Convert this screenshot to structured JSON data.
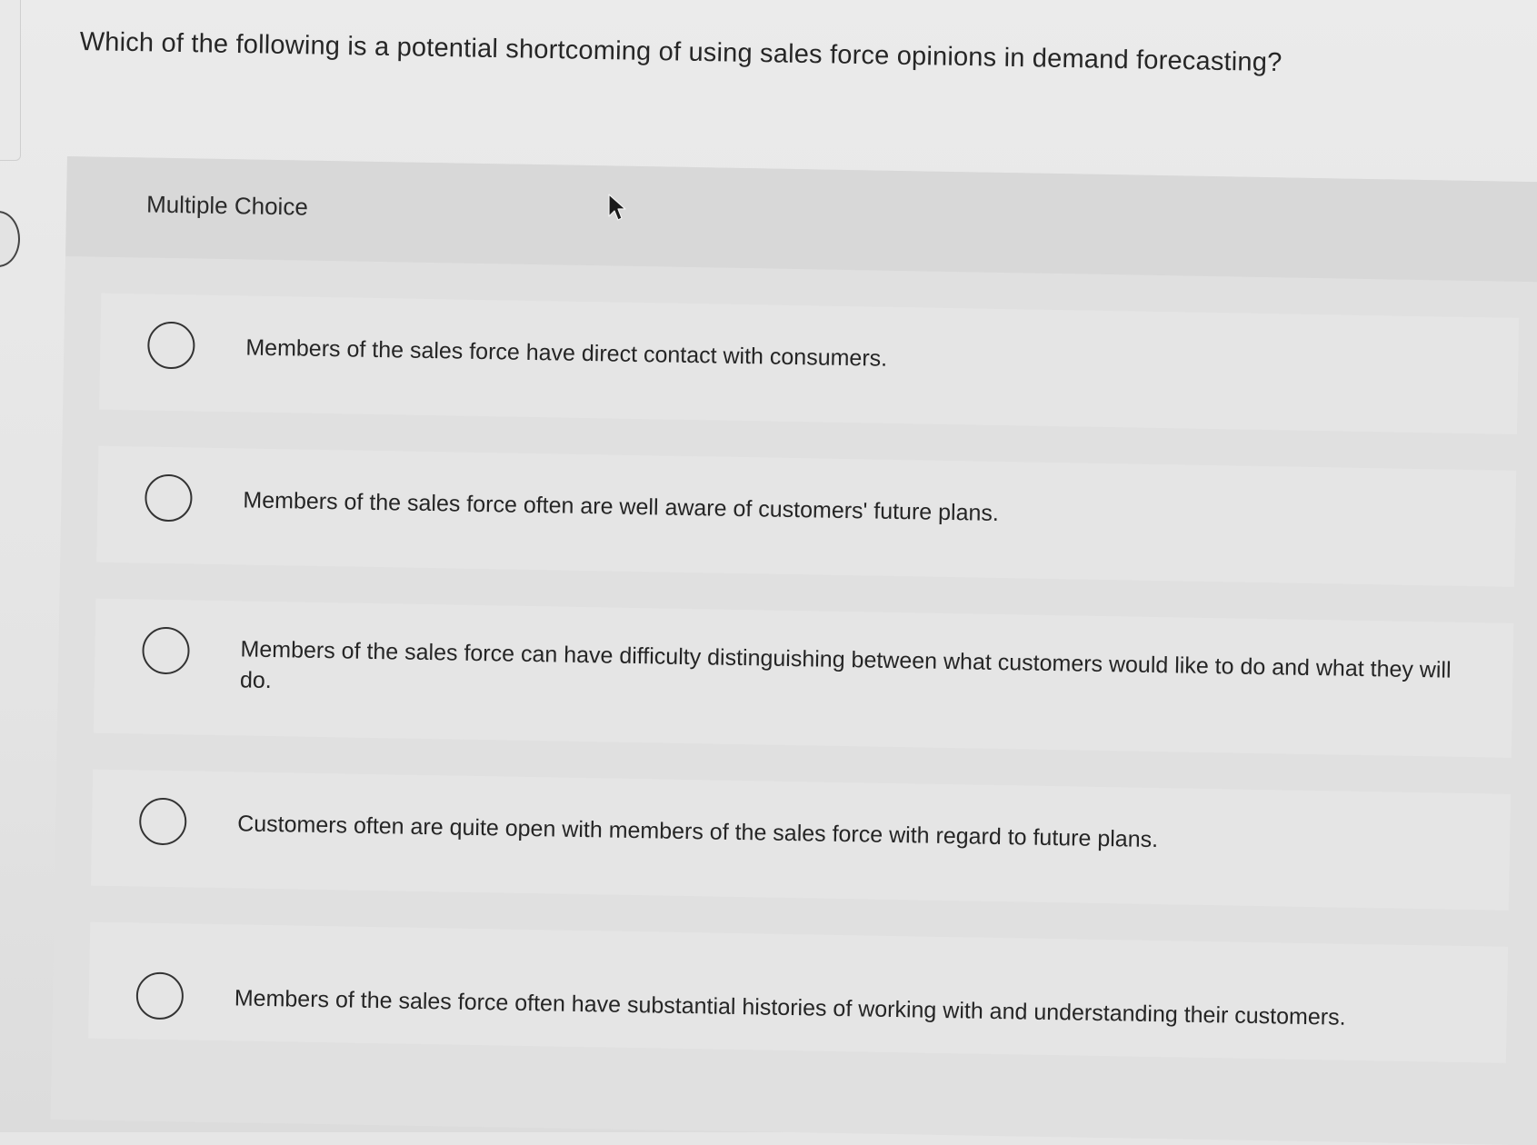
{
  "question": {
    "text": "Which of the following is a potential shortcoming of using sales force opinions in demand forecasting?"
  },
  "section": {
    "label": "Multiple Choice"
  },
  "options": [
    {
      "label": "Members of the sales force have direct contact with consumers.",
      "selected": false
    },
    {
      "label": "Members of the sales force often are well aware of customers' future plans.",
      "selected": false
    },
    {
      "label": "Members of the sales force can have difficulty distinguishing between what customers would like to do and what they will do.",
      "selected": false
    },
    {
      "label": "Customers often are quite open with members of the sales force with regard to future plans.",
      "selected": false
    },
    {
      "label": "Members of the sales force often have substantial histories of working with and understanding their customers.",
      "selected": false
    }
  ],
  "icons": {
    "pointer": "mouse-pointer-icon",
    "radio": "radio-button-icon"
  },
  "colors": {
    "background": "#e6e6e6",
    "panel": "#e0e0e0",
    "text": "#262626"
  }
}
